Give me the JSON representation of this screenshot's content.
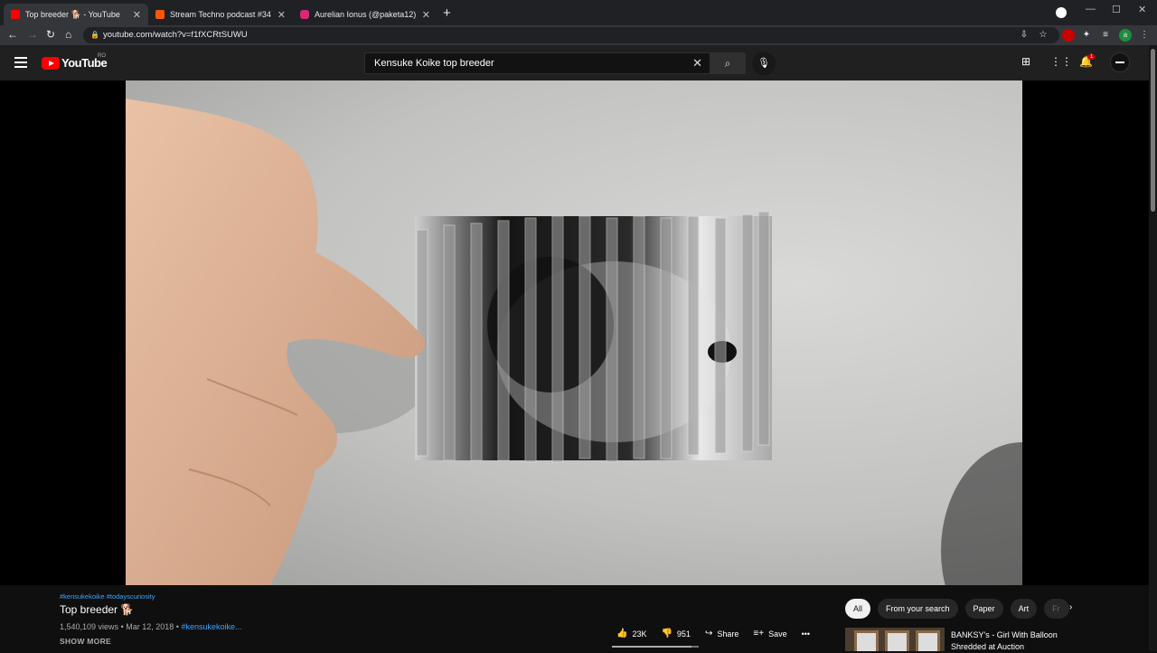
{
  "browser": {
    "tabs": [
      {
        "title": "Top breeder 🐕 - YouTube",
        "active": true,
        "favicon_color": "#ff0000"
      },
      {
        "title": "Stream Techno podcast #34 | dol",
        "active": false,
        "favicon_color": "#ff5500"
      },
      {
        "title": "Aurelian Ionus (@paketa12) • Ins",
        "active": false,
        "favicon_color": "#d62976"
      }
    ],
    "url": "youtube.com/watch?v=f1fXCRtSUWU",
    "profile_initial": "a"
  },
  "youtube": {
    "logo_text": "YouTube",
    "region": "RO",
    "search_query": "Kensuke Koike top breeder",
    "notification_count": "1"
  },
  "video": {
    "tags": "#kensukekoike #todayscuriosity",
    "title": "Top breeder 🐕",
    "views": "1,540,109 views",
    "date": "Mar 12, 2018",
    "desc_tag": "#kensukekoike...",
    "show_more": "SHOW MORE",
    "likes": "23K",
    "dislikes": "951",
    "share_label": "Share",
    "save_label": "Save",
    "like_ratio": 0.92
  },
  "chips": [
    "All",
    "From your search",
    "Paper",
    "Art",
    "Fr"
  ],
  "recommendation": {
    "title": "BANKSY's - Girl With Balloon Shredded at Auction"
  },
  "colors": {
    "yt_red": "#ff0000",
    "link_blue": "#3ea6ff",
    "bg": "#0f0f0f"
  }
}
